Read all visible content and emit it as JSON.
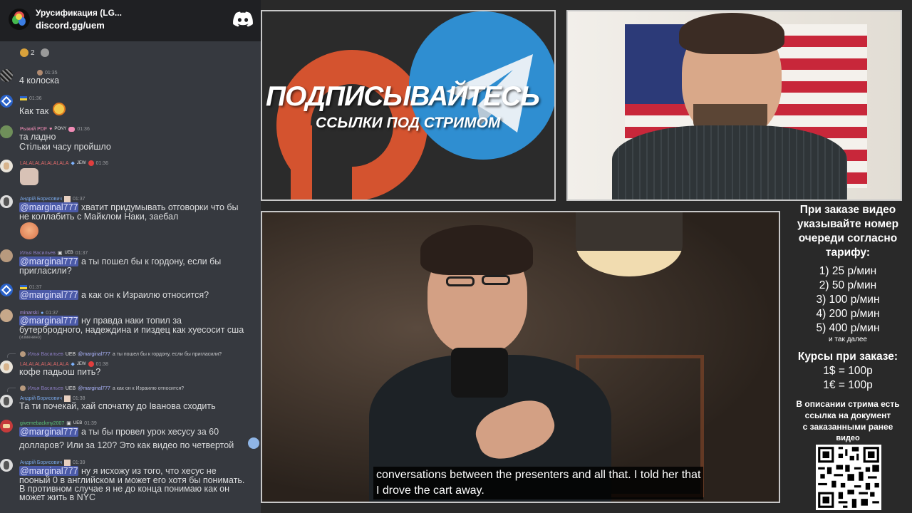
{
  "chat": {
    "server_name": "Урусификация (LG...",
    "server_invite": "discord.gg/uem",
    "reactions": [
      {
        "count": "2"
      },
      {
        "count": ""
      }
    ],
    "messages": [
      {
        "author": "",
        "time": "01:35",
        "text": "4 колоска"
      },
      {
        "author": "",
        "time": "01:36",
        "text": "Как так"
      },
      {
        "author": "Рыжий PDF",
        "badge": "PONY",
        "time": "01:36",
        "lines": [
          "та ладно",
          "Стільки часу пройшло"
        ]
      },
      {
        "author": "LALALALALALALALA",
        "badge": "JEW",
        "time": "01:36",
        "text": ""
      },
      {
        "author": "Андрій Борисович",
        "time": "01:37",
        "mention": "@marginal777",
        "lines": [
          "хватит придумывать отговорки что бы",
          "не коллабить с Майклом Наки, заебал"
        ]
      },
      {
        "author": "Илья Васильев",
        "badge": "UEB",
        "time": "01:37",
        "mention": "@marginal777",
        "lines": [
          "а ты пошел бы к гордону, если бы",
          "пригласили?"
        ]
      },
      {
        "author": "",
        "time": "01:37",
        "mention": "@marginal777",
        "text": "а как он к Израилю относится?"
      },
      {
        "author": "minarski",
        "time": "01:37",
        "mention": "@marginal777",
        "lines": [
          "ну правда наки топил за",
          "бутербродного, надеждина и пиздец как хуесосит сша"
        ],
        "edited": "(изменено)"
      },
      {
        "reply_author": "Илья Васильев",
        "reply_badge": "UEB",
        "reply_mention": "@marginal777",
        "reply_text": "а ты пошел бы к гордону, если бы пригласили?",
        "author": "LALALALALALALALA",
        "badge": "JEW",
        "time": "01:38",
        "text": "кофе падьош пить?"
      },
      {
        "reply_author": "Илья Васильев",
        "reply_badge": "UEB",
        "reply_mention": "@marginal777",
        "reply_text": "а как он к Израилю относится?",
        "author": "Андрій Борисович",
        "time": "01:38",
        "text": "Та ти почекай, хай спочатку до Іванова сходить"
      },
      {
        "author": "givemebackmy2007",
        "badge": "UEB",
        "time": "01:39",
        "mention": "@marginal777",
        "lines": [
          "а ты бы провел урок хесусу за 60",
          "долларов? Или за 120? Это как видео по четвертой"
        ]
      },
      {
        "author": "Андрій Борисович",
        "time": "01:39",
        "mention": "@marginal777",
        "lines": [
          "ну я исхожу из того, что хесус не",
          "пооный 0 в английском и может его хотя бы понимать.",
          "В противном случае я не до конца понимаю как он",
          "может жить в NYC"
        ]
      }
    ]
  },
  "promo": {
    "title": "ПОДПИСЫВАЙТЕСЬ",
    "subtitle": "ССЫЛКИ ПОД СТРИМОМ"
  },
  "video": {
    "caption_line1": "conversations between the presenters and all that. I told her that",
    "caption_line2": "I drove the cart away."
  },
  "info": {
    "heading": [
      "При заказе видео",
      "указывайте номер",
      "очереди согласно",
      "тарифу:"
    ],
    "tariffs": [
      "1) 25 р/мин",
      "2) 50 р/мин",
      "3) 100 р/мин",
      "4) 200 р/мин",
      "5) 400 р/мин"
    ],
    "tariffs_more": "и так далее",
    "rates_title": "Курсы при заказе:",
    "rates": [
      "1$ = 100р",
      "1€ = 100р"
    ],
    "description": [
      "В описании стрима есть",
      "ссылка на документ",
      "с заказанными ранее",
      "видео"
    ]
  },
  "colors": {
    "chat_bg": "#36393f",
    "header_bg": "#1f2023",
    "mention_bg": "#4b5aa8",
    "patreon": "#e0573a",
    "telegram": "#2f93d4"
  }
}
